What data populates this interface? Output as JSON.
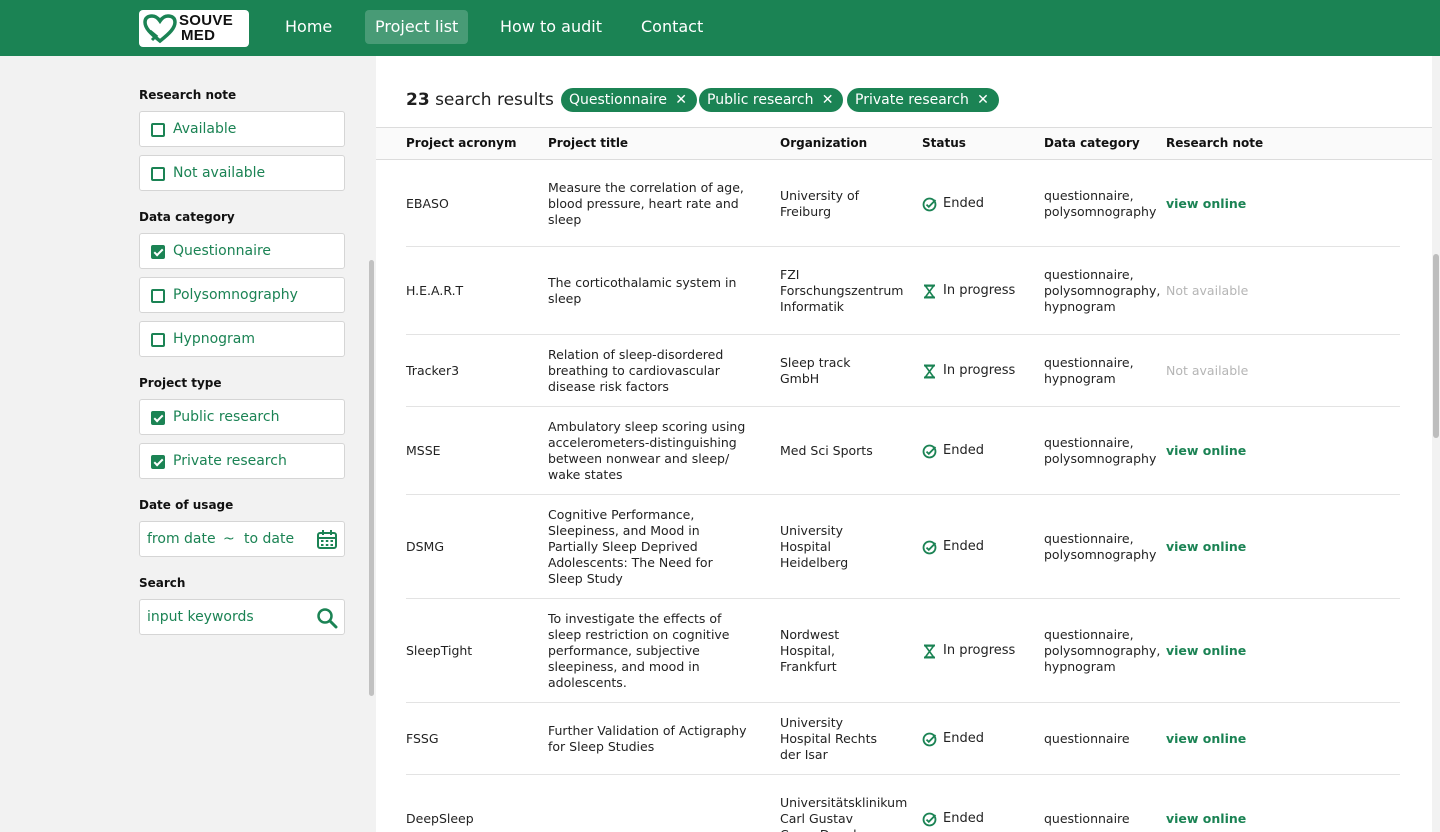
{
  "brand": {
    "logo_line1": "SOUVE",
    "logo_line2": "MED",
    "color": "#1b8354"
  },
  "nav": {
    "items": [
      "Home",
      "Project list",
      "How to audit",
      "Contact"
    ],
    "active": "Project list"
  },
  "filters": {
    "research_note": {
      "label": "Research note",
      "options": [
        {
          "label": "Available",
          "checked": false
        },
        {
          "label": "Not available",
          "checked": false
        }
      ]
    },
    "data_category": {
      "label": "Data category",
      "options": [
        {
          "label": "Questionnaire",
          "checked": true
        },
        {
          "label": "Polysomnography",
          "checked": false
        },
        {
          "label": "Hypnogram",
          "checked": false
        }
      ]
    },
    "project_type": {
      "label": "Project type",
      "options": [
        {
          "label": "Public research",
          "checked": true
        },
        {
          "label": "Private research",
          "checked": true
        }
      ]
    },
    "date": {
      "label": "Date of usage",
      "from": "from date",
      "sep": "~",
      "to": "to date",
      "icon": "calendar-icon"
    },
    "search": {
      "label": "Search",
      "placeholder": "input keywords",
      "icon": "search-icon"
    }
  },
  "results": {
    "count": "23",
    "label": "search results",
    "chips": [
      "Questionnaire",
      "Public research",
      "Private research"
    ]
  },
  "table": {
    "columns": [
      "Project acronym",
      "Project title",
      "Organization",
      "Status",
      "Data category",
      "Research note"
    ],
    "rows": [
      {
        "acronym": "EBASO",
        "title": "Measure the correlation of age, blood pressure, heart rate and sleep",
        "org": "University of Freiburg",
        "status": "Ended",
        "category": "questionnaire, polysomnography",
        "note": "view online"
      },
      {
        "acronym": "H.E.A.R.T",
        "title": "The corticothalamic system in sleep",
        "org": "FZI Forschungszentrum Informatik",
        "status": "In progress",
        "category": "questionnaire, polysomnography, hypnogram",
        "note": "Not available"
      },
      {
        "acronym": "Tracker3",
        "title": "Relation of sleep-disordered breathing to cardiovascular disease risk factors",
        "org": "Sleep track GmbH",
        "status": "In progress",
        "category": "questionnaire, hypnogram",
        "note": "Not available"
      },
      {
        "acronym": "MSSE",
        "title": "Ambulatory sleep scoring using accelerometers-distinguishing between nonwear and sleep/ wake states",
        "org": "Med Sci Sports",
        "status": "Ended",
        "category": "questionnaire, polysomnography",
        "note": "view online"
      },
      {
        "acronym": "DSMG",
        "title": "Cognitive Performance, Sleepiness, and Mood in Partially Sleep Deprived Adolescents: The Need for Sleep Study",
        "org": "University Hospital Heidelberg",
        "status": "Ended",
        "category": "questionnaire, polysomnography",
        "note": "view online"
      },
      {
        "acronym": "SleepTight",
        "title": "To investigate the effects of sleep restriction on cognitive performance, subjective sleepiness, and mood in adolescents.",
        "org": "Nordwest Hospital, Frankfurt",
        "status": "In progress",
        "category": "questionnaire, polysomnography, hypnogram",
        "note": "view online"
      },
      {
        "acronym": "FSSG",
        "title": "Further Validation of Actigraphy for Sleep Studies",
        "org": "University Hospital Rechts der Isar",
        "status": "Ended",
        "category": "questionnaire",
        "note": "view online"
      },
      {
        "acronym": "DeepSleep",
        "title": "",
        "org": "Universitätsklinikum Carl Gustav Carus Dresden",
        "status": "Ended",
        "category": "questionnaire",
        "note": "view online"
      }
    ]
  }
}
